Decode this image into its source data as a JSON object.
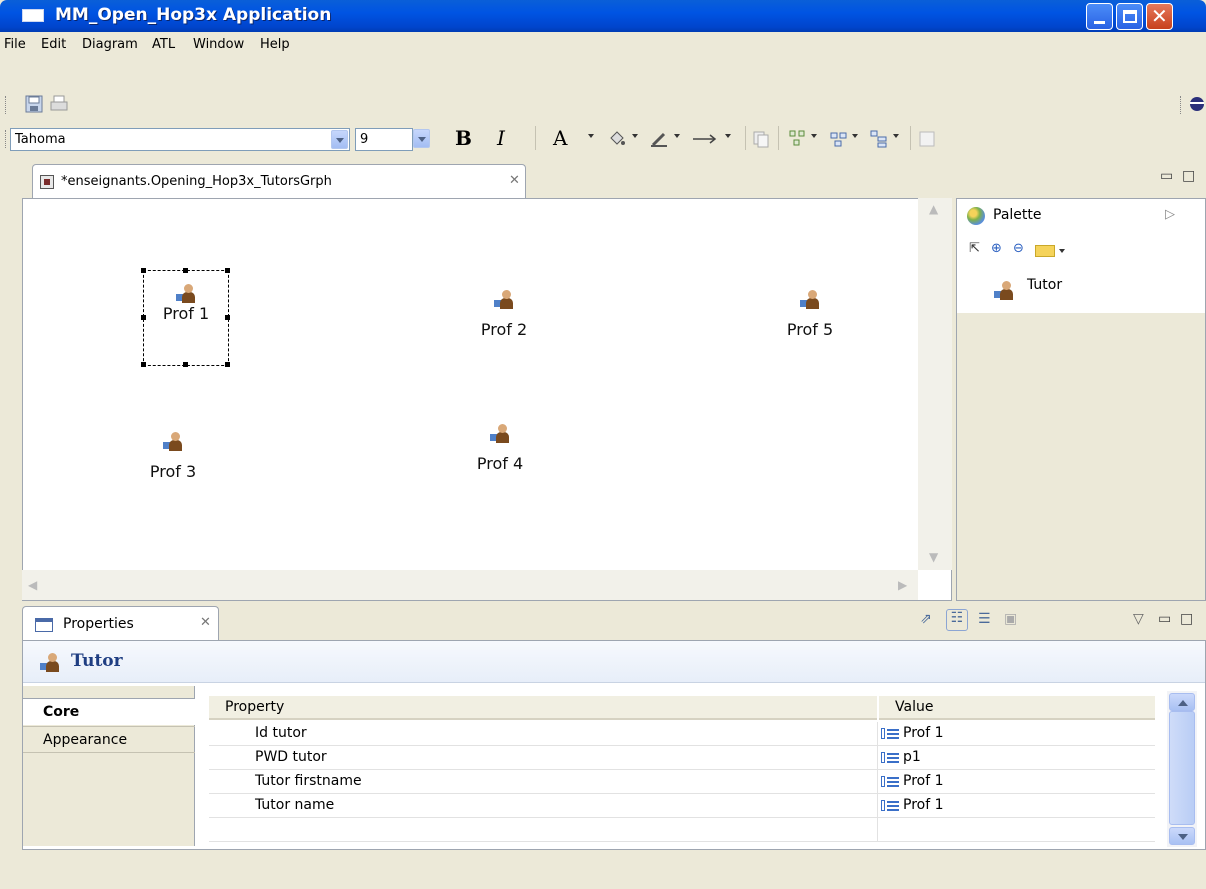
{
  "window": {
    "title": "MM_Open_Hop3x Application"
  },
  "menu": [
    "File",
    "Edit",
    "Diagram",
    "ATL",
    "Window",
    "Help"
  ],
  "toolbar": {
    "font_family": "Tahoma",
    "font_size": "9",
    "bold_label": "B",
    "italic_label": "I",
    "font_color_label": "A"
  },
  "editor": {
    "tab_title": "*enseignants.Opening_Hop3x_TutorsGrph",
    "close_glyph": "✕"
  },
  "diagram": {
    "nodes": [
      {
        "label": "Prof 1",
        "selected": true
      },
      {
        "label": "Prof 2"
      },
      {
        "label": "Prof 5"
      },
      {
        "label": "Prof 3"
      },
      {
        "label": "Prof 4"
      }
    ]
  },
  "palette": {
    "title": "Palette",
    "entries": [
      {
        "label": "Tutor",
        "icon": "tutor-icon"
      }
    ]
  },
  "properties": {
    "tab_title": "Properties",
    "header": "Tutor",
    "side_tabs": [
      "Core",
      "Appearance"
    ],
    "columns": [
      "Property",
      "Value"
    ],
    "rows": [
      {
        "property": "Id tutor",
        "value": "Prof 1"
      },
      {
        "property": "PWD tutor",
        "value": "p1"
      },
      {
        "property": "Tutor firstname",
        "value": "Prof 1"
      },
      {
        "property": "Tutor name",
        "value": "Prof 1"
      }
    ]
  },
  "colors": {
    "titlebar": "#0054e3",
    "chrome": "#ece9d8",
    "accent": "#1f3e82"
  }
}
